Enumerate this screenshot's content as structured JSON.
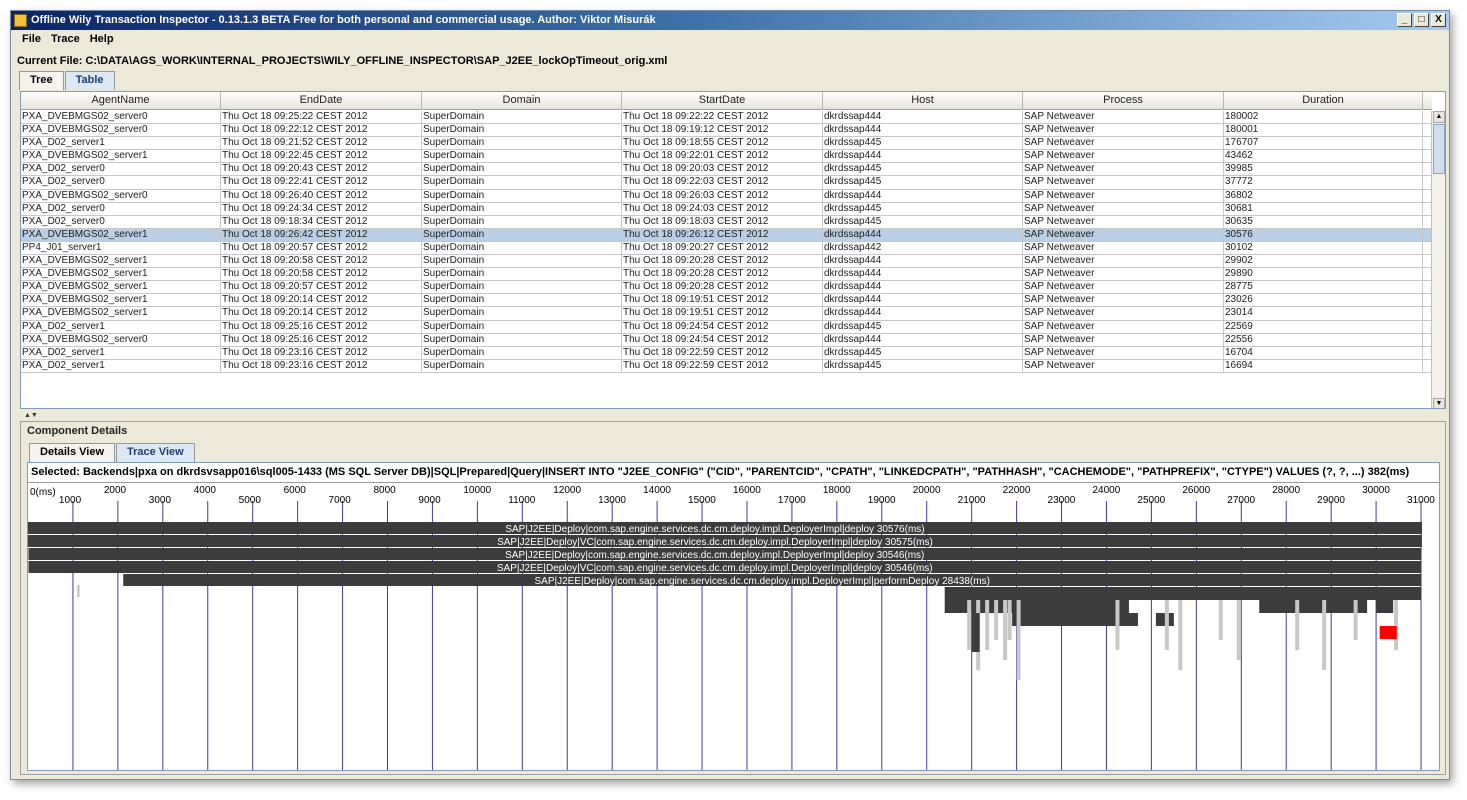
{
  "window": {
    "title": "Offline Wily Transaction Inspector - 0.13.1.3 BETA Free for both personal and commercial usage. Author: Viktor Misurák",
    "buttons": {
      "minimize": "_",
      "maximize": "□",
      "close": "X"
    }
  },
  "menu": [
    "File",
    "Trace",
    "Help"
  ],
  "current_file": "Current File: C:\\DATA\\AGS_WORK\\INTERNAL_PROJECTS\\WILY_OFFLINE_INSPECTOR\\SAP_J2EE_lockOpTimeout_orig.xml",
  "top_tabs": [
    {
      "label": "Tree",
      "active": false
    },
    {
      "label": "Table",
      "active": true
    }
  ],
  "table": {
    "columns": [
      "AgentName",
      "EndDate",
      "Domain",
      "StartDate",
      "Host",
      "Process",
      "Duration"
    ],
    "selected_row": 9,
    "rows": [
      [
        "PXA_DVEBMGS02_server0",
        "Thu Oct 18 09:25:22 CEST 2012",
        "SuperDomain",
        "Thu Oct 18 09:22:22 CEST 2012",
        "dkrdssap444",
        "SAP Netweaver",
        "180002"
      ],
      [
        "PXA_DVEBMGS02_server0",
        "Thu Oct 18 09:22:12 CEST 2012",
        "SuperDomain",
        "Thu Oct 18 09:19:12 CEST 2012",
        "dkrdssap444",
        "SAP Netweaver",
        "180001"
      ],
      [
        "PXA_D02_server1",
        "Thu Oct 18 09:21:52 CEST 2012",
        "SuperDomain",
        "Thu Oct 18 09:18:55 CEST 2012",
        "dkrdssap445",
        "SAP Netweaver",
        "176707"
      ],
      [
        "PXA_DVEBMGS02_server1",
        "Thu Oct 18 09:22:45 CEST 2012",
        "SuperDomain",
        "Thu Oct 18 09:22:01 CEST 2012",
        "dkrdssap444",
        "SAP Netweaver",
        "43462"
      ],
      [
        "PXA_D02_server0",
        "Thu Oct 18 09:20:43 CEST 2012",
        "SuperDomain",
        "Thu Oct 18 09:20:03 CEST 2012",
        "dkrdssap445",
        "SAP Netweaver",
        "39985"
      ],
      [
        "PXA_D02_server0",
        "Thu Oct 18 09:22:41 CEST 2012",
        "SuperDomain",
        "Thu Oct 18 09:22:03 CEST 2012",
        "dkrdssap445",
        "SAP Netweaver",
        "37772"
      ],
      [
        "PXA_DVEBMGS02_server0",
        "Thu Oct 18 09:26:40 CEST 2012",
        "SuperDomain",
        "Thu Oct 18 09:26:03 CEST 2012",
        "dkrdssap444",
        "SAP Netweaver",
        "36802"
      ],
      [
        "PXA_D02_server0",
        "Thu Oct 18 09:24:34 CEST 2012",
        "SuperDomain",
        "Thu Oct 18 09:24:03 CEST 2012",
        "dkrdssap445",
        "SAP Netweaver",
        "30681"
      ],
      [
        "PXA_D02_server0",
        "Thu Oct 18 09:18:34 CEST 2012",
        "SuperDomain",
        "Thu Oct 18 09:18:03 CEST 2012",
        "dkrdssap445",
        "SAP Netweaver",
        "30635"
      ],
      [
        "PXA_DVEBMGS02_server1",
        "Thu Oct 18 09:26:42 CEST 2012",
        "SuperDomain",
        "Thu Oct 18 09:26:12 CEST 2012",
        "dkrdssap444",
        "SAP Netweaver",
        "30576"
      ],
      [
        "PP4_J01_server1",
        "Thu Oct 18 09:20:57 CEST 2012",
        "SuperDomain",
        "Thu Oct 18 09:20:27 CEST 2012",
        "dkrdssap442",
        "SAP Netweaver",
        "30102"
      ],
      [
        "PXA_DVEBMGS02_server1",
        "Thu Oct 18 09:20:58 CEST 2012",
        "SuperDomain",
        "Thu Oct 18 09:20:28 CEST 2012",
        "dkrdssap444",
        "SAP Netweaver",
        "29902"
      ],
      [
        "PXA_DVEBMGS02_server1",
        "Thu Oct 18 09:20:58 CEST 2012",
        "SuperDomain",
        "Thu Oct 18 09:20:28 CEST 2012",
        "dkrdssap444",
        "SAP Netweaver",
        "29890"
      ],
      [
        "PXA_DVEBMGS02_server1",
        "Thu Oct 18 09:20:57 CEST 2012",
        "SuperDomain",
        "Thu Oct 18 09:20:28 CEST 2012",
        "dkrdssap444",
        "SAP Netweaver",
        "28775"
      ],
      [
        "PXA_DVEBMGS02_server1",
        "Thu Oct 18 09:20:14 CEST 2012",
        "SuperDomain",
        "Thu Oct 18 09:19:51 CEST 2012",
        "dkrdssap444",
        "SAP Netweaver",
        "23026"
      ],
      [
        "PXA_DVEBMGS02_server1",
        "Thu Oct 18 09:20:14 CEST 2012",
        "SuperDomain",
        "Thu Oct 18 09:19:51 CEST 2012",
        "dkrdssap444",
        "SAP Netweaver",
        "23014"
      ],
      [
        "PXA_D02_server1",
        "Thu Oct 18 09:25:16 CEST 2012",
        "SuperDomain",
        "Thu Oct 18 09:24:54 CEST 2012",
        "dkrdssap445",
        "SAP Netweaver",
        "22569"
      ],
      [
        "PXA_DVEBMGS02_server0",
        "Thu Oct 18 09:25:16 CEST 2012",
        "SuperDomain",
        "Thu Oct 18 09:24:54 CEST 2012",
        "dkrdssap444",
        "SAP Netweaver",
        "22556"
      ],
      [
        "PXA_D02_server1",
        "Thu Oct 18 09:23:16 CEST 2012",
        "SuperDomain",
        "Thu Oct 18 09:22:59 CEST 2012",
        "dkrdssap445",
        "SAP Netweaver",
        "16704"
      ],
      [
        "PXA_D02_server1",
        "Thu Oct 18 09:23:16 CEST 2012",
        "SuperDomain",
        "Thu Oct 18 09:22:59 CEST 2012",
        "dkrdssap445",
        "SAP Netweaver",
        "16694"
      ]
    ]
  },
  "component_details": {
    "title": "Component Details",
    "tabs": [
      {
        "label": "Details View",
        "active": false
      },
      {
        "label": "Trace View",
        "active": true
      }
    ],
    "selected_text": "Selected: Backends|pxa on dkrdsvsapp016\\sql005-1433 (MS SQL Server DB)|SQL|Prepared|Query|INSERT INTO \"J2EE_CONFIG\" (\"CID\", \"PARENTCID\", \"CPATH\", \"LINKEDCPATH\", \"PATHHASH\", \"CACHEMODE\", \"PATHPREFIX\", \"CTYPE\") VALUES (?, ?, ...) 382(ms)"
  },
  "trace": {
    "axis_max_ms": 31400,
    "tick_step_ms": 1000,
    "zero_label": "0(ms)",
    "colors": {
      "bar": "#3c3c3c",
      "text": "#ffffff",
      "grid": "#3c3ca0",
      "light": "#c8c8c8",
      "highlight": "#ff0000"
    },
    "bars": [
      {
        "label": "SAP|J2EE|Deploy|com.sap.engine.services.dc.cm.deploy.impl.DeployerImpl|deploy 30576(ms)",
        "start": 0,
        "duration": 30576
      },
      {
        "label": "SAP|J2EE|Deploy|VC|com.sap.engine.services.dc.cm.deploy.impl.DeployerImpl|deploy 30575(ms)",
        "start": 0,
        "duration": 30575
      },
      {
        "label": "SAP|J2EE|Deploy|com.sap.engine.services.dc.cm.deploy.impl.DeployerImpl|deploy 30546(ms)",
        "start": 10,
        "duration": 30546
      },
      {
        "label": "SAP|J2EE|Deploy|VC|com.sap.engine.services.dc.cm.deploy.impl.DeployerImpl|deploy 30546(ms)",
        "start": 10,
        "duration": 30546
      },
      {
        "label": "SAP|J2EE|Deploy|com.sap.engine.services.dc.cm.deploy.impl.DeployerImpl|performDeploy 28438(ms)",
        "start": 2120,
        "duration": 28438
      }
    ],
    "highlight": {
      "start": 30080,
      "duration": 380
    }
  }
}
